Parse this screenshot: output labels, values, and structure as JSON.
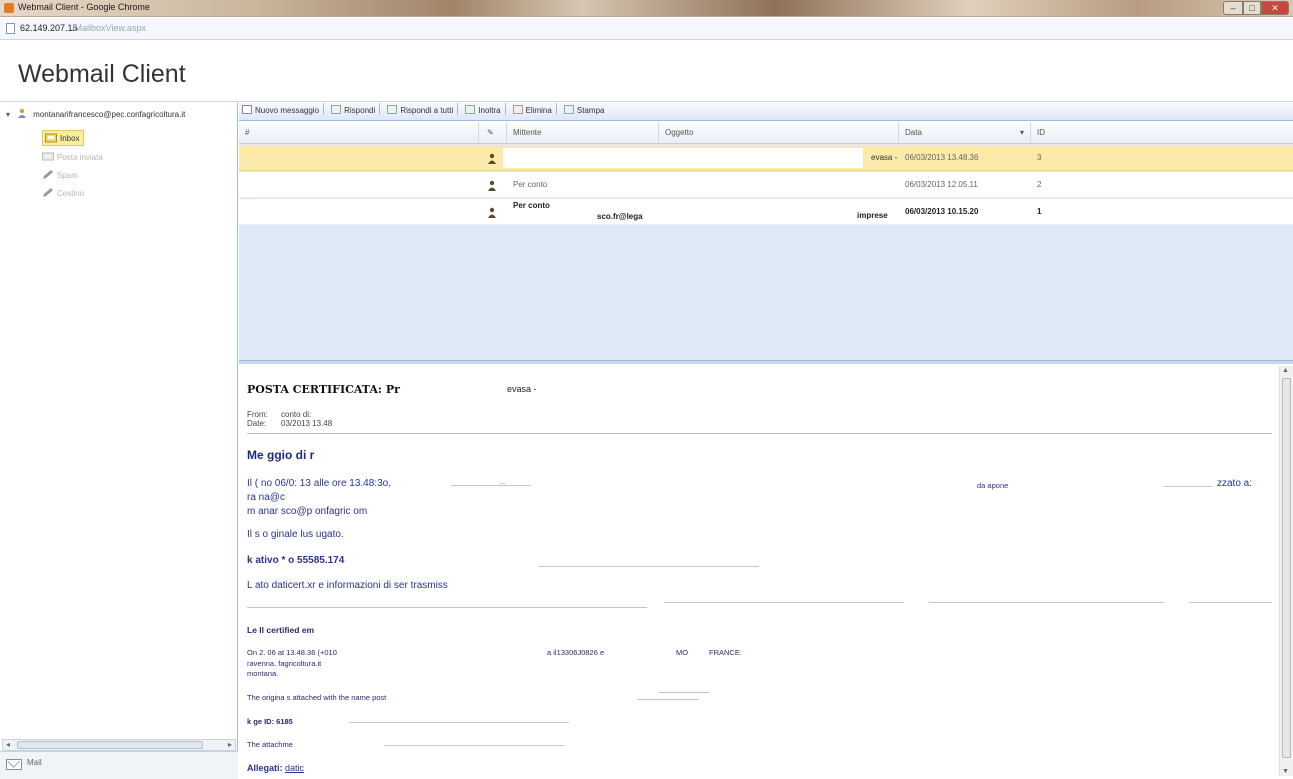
{
  "browser": {
    "window_title": "Webmail Client - Google Chrome",
    "url_host": "62.149.207.15",
    "url_path": "/MailboxView.aspx"
  },
  "app": {
    "title": "Webmail Client"
  },
  "tree": {
    "account": "montanarifrancesco@pec.confagricoltura.it",
    "folders": [
      {
        "label": "Inbox",
        "icon": "inbox-icon",
        "selected": true
      },
      {
        "label": "Posta inviata",
        "icon": "sent-icon",
        "selected": false
      },
      {
        "label": "Spam",
        "icon": "pencil-icon",
        "selected": false
      },
      {
        "label": "Cestino",
        "icon": "pencil-icon",
        "selected": false
      }
    ],
    "footer_label": "Mail"
  },
  "toolbar": {
    "new_message": "Nuovo messaggio",
    "reply": "Rispondi",
    "reply_all": "Rispondi a tutti",
    "forward": "Inoltra",
    "delete": "Elimina",
    "print": "Stampa"
  },
  "grid": {
    "columns": {
      "hash": "#",
      "sender": "Mittente",
      "subject": "Oggetto",
      "date": "Data",
      "id": "ID"
    },
    "sort_indicator": "▾",
    "rows": [
      {
        "sender": "",
        "subject_tail": "evasa -",
        "date": "06/03/2013 13.48.36",
        "id": "3",
        "unread": false,
        "selected": true
      },
      {
        "sender": "Per conto",
        "subject_tail": "",
        "date": "06/03/2013 12.05.11",
        "id": "2",
        "unread": false,
        "selected": false
      },
      {
        "sender": "Per conto",
        "sender_tail": "sco.fr@lega",
        "subject_tail": "imprese",
        "date": "06/03/2013 10.15.20",
        "id": "1",
        "unread": true,
        "selected": false
      }
    ]
  },
  "preview": {
    "subject": "POSTA CERTIFICATA: Pr",
    "subject_tail": "evasa -",
    "from_label": "From:",
    "from_value": "conto di:",
    "date_label": "Date:",
    "date_value": "03/2013 13.48",
    "heading": "Me     ggio di r",
    "line1": "Il (    no 06/0:    13 alle ore 13.48:3o,",
    "line1_right": "da   apone",
    "line1_far": "zzato a:",
    "line2": "ra    na@c",
    "line3": "m      anar        sco@p      onfagric         om",
    "line4": "Il     s     o    ginale       lus       ugato.",
    "line5": "k         ativo        *         o       55585.174",
    "line6": "L        ato daticert.xr       e informazioni di ser          trasmiss",
    "legal_heading": "Le      ll certified em",
    "en_line1": "On 2.      06 at 13.48.36 (+010",
    "en_line1_mid": "a il13306J0826 e",
    "en_line1_right": "MO",
    "en_line1_far": "FRANCE:",
    "en_line2": "ravenna.      fagricoltura.it",
    "en_line3": "montana.",
    "en_line4": "The origina              s attached with the name post",
    "en_line5": "k       ge ID: 6185",
    "en_line6": "The            attachme",
    "attachments_label": "Allegati:",
    "attachments_value": "datic"
  }
}
